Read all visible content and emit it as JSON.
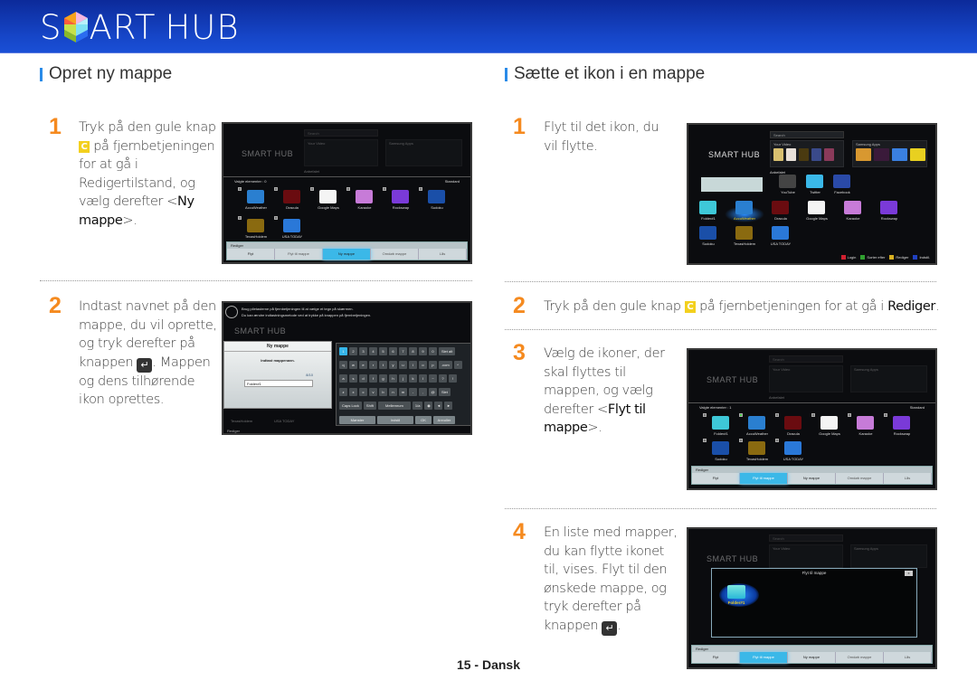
{
  "header": {
    "logo_text": "SMART HUB",
    "logo_s": "S",
    "logo_rest": "ART",
    "logo_hub": "HUB"
  },
  "left": {
    "title": "Opret ny mappe",
    "steps": [
      {
        "number": "1",
        "text_a": "Tryk på den gule knap",
        "key": "C",
        "text_b": "på fjernbetjeningen for at gå i Redigertilstand, og vælg derefter <",
        "bold": "Ny mappe",
        "text_c": ">."
      },
      {
        "number": "2",
        "text_a": "Indtast navnet på den mappe, du vil oprette, og tryk derefter på knappen",
        "key": "↵",
        "text_b": ". Mappen og dens tilhørende ikon oprettes."
      }
    ]
  },
  "right": {
    "title": "Sætte et ikon i en mappe",
    "steps": [
      {
        "number": "1",
        "text": "Flyt til det ikon, du vil flytte."
      },
      {
        "number": "2",
        "text_a": "Tryk på den gule knap",
        "key": "C",
        "text_b": "på fjernbetjeningen for at gå i",
        "bold": "Rediger",
        "text_c": "."
      },
      {
        "number": "3",
        "text_a": "Vælg de ikoner, der skal flyttes til mappen, og vælg derefter <",
        "bold": "Flyt til mappe",
        "text_c": ">."
      },
      {
        "number": "4",
        "text_a": "En liste med mapper, du kan flytte ikonet til, vises. Flyt til den ønskede mappe, og tryk derefter på knappen",
        "key": "↵",
        "text_c": "."
      }
    ]
  },
  "footer": {
    "page": "15 - Dansk"
  },
  "tv_common": {
    "logo": "SMART HUB",
    "search": "Search",
    "your_video": "Your Video",
    "samsung_apps": "Samsung Apps",
    "recommended": "Anbefalet",
    "standard": "Standard",
    "edit_title": "Rediger",
    "close": "x"
  },
  "screens": {
    "edit_new_folder": {
      "selected": "Valgte elementer : 0",
      "apps": [
        {
          "name": "AccuWeather",
          "color": "#2a7fd0"
        },
        {
          "name": "Dracula",
          "color": "#6a0c10"
        },
        {
          "name": "Google Maps",
          "color": "#f4f4f4"
        },
        {
          "name": "Karaoke",
          "color": "#c77bd8"
        },
        {
          "name": "Rockswap",
          "color": "#7a3ad8"
        },
        {
          "name": "Sudoku",
          "color": "#1a4fa8"
        },
        {
          "name": "TexasHoldem",
          "color": "#8a6a10"
        },
        {
          "name": "USA TODAY",
          "color": "#2a78d8"
        }
      ],
      "buttons": [
        "Flyt",
        "Flyt til mappe",
        "Ny mappe",
        "Omdøb mappe",
        "Lås"
      ],
      "active_button": 2
    },
    "keyboard": {
      "hint_1": "Brug piletasterne på fjernbetjeningen til at vælge et tegn på skærmen.",
      "hint_2": "Du kan ændre indtastningsmetode ved at trykke på knappen på fjernbetjeningen.",
      "dialog_title": "Ny mappe",
      "prompt": "Indtast mappenavn.",
      "counter": "8/10",
      "value": "Folder#1",
      "rows": [
        [
          "1",
          "2",
          "3",
          "4",
          "5",
          "6",
          "7",
          "8",
          "9",
          "0",
          "Slet alt"
        ],
        [
          "q",
          "w",
          "e",
          "r",
          "t",
          "y",
          "u",
          "i",
          "o",
          "p",
          ".com",
          "^"
        ],
        [
          "a",
          "s",
          "d",
          "f",
          "g",
          "h",
          "j",
          "k",
          "l",
          "~",
          "?",
          "!"
        ],
        [
          "z",
          "x",
          "c",
          "v",
          "b",
          "n",
          "m",
          "-",
          ",",
          "@",
          "Slet"
        ],
        [
          "Caps Lock",
          "Shift",
          "Mellemrum",
          "1/a",
          "◉",
          "◄",
          "►"
        ]
      ],
      "bottom_buttons": [
        "Mønster",
        "Indstil",
        "OK",
        "Annuller"
      ],
      "behind": [
        "TexasHoldem",
        "USA TODAY"
      ],
      "edit_title": "Rediger"
    },
    "home": {
      "apps_top": [
        "YouTube",
        "Twitter",
        "Facebook"
      ],
      "apps": [
        {
          "name": "Folder#1",
          "color": "#3ec8d8"
        },
        {
          "name": "AccuWeather",
          "color": "#2a7fd0"
        },
        {
          "name": "Dracula",
          "color": "#6a0c10"
        },
        {
          "name": "Google Maps",
          "color": "#f4f4f4"
        },
        {
          "name": "Karaoke",
          "color": "#c77bd8"
        },
        {
          "name": "Rockswap",
          "color": "#7a3ad8"
        },
        {
          "name": "Sudoku",
          "color": "#1a4fa8"
        },
        {
          "name": "TexasHoldem",
          "color": "#8a6a10"
        },
        {
          "name": "USA TODAY",
          "color": "#2a78d8"
        }
      ],
      "focused": "AccuWeather",
      "footer": [
        {
          "key": "A",
          "label": "Login",
          "color": "#d02030"
        },
        {
          "key": "B",
          "label": "Sorter efter",
          "color": "#30a030"
        },
        {
          "key": "C",
          "label": "Rediger",
          "color": "#d8b020"
        },
        {
          "key": "D",
          "label": "Indstil.",
          "color": "#2040c0"
        }
      ]
    },
    "edit_move": {
      "selected": "Valgte elementer : 1",
      "apps": [
        {
          "name": "Folder#1",
          "color": "#3ec8d8"
        },
        {
          "name": "AccuWeather",
          "color": "#2a7fd0"
        },
        {
          "name": "Dracula",
          "color": "#6a0c10"
        },
        {
          "name": "Google Maps",
          "color": "#f4f4f4"
        },
        {
          "name": "Karaoke",
          "color": "#c77bd8"
        },
        {
          "name": "Rockswap",
          "color": "#7a3ad8"
        },
        {
          "name": "Sudoku",
          "color": "#1a4fa8"
        },
        {
          "name": "TexasHoldem",
          "color": "#8a6a10"
        },
        {
          "name": "USA TODAY",
          "color": "#2a78d8"
        }
      ],
      "checked": 1,
      "buttons": [
        "Flyt",
        "Flyt til mappe",
        "Ny mappe",
        "Omdøb mappe",
        "Lås"
      ],
      "active_button": 1
    },
    "move_dialog": {
      "title": "Flyt til mappe",
      "folder": "Folder#1",
      "buttons": [
        "Flyt",
        "Flyt til mappe",
        "Ny mappe",
        "Omdøb mappe",
        "Lås"
      ],
      "active_button": 1
    }
  },
  "colors": {
    "header_blue": "#1646c8",
    "accent_bar": "#2a8be8",
    "step_number": "#f58a1f",
    "yellow_key": "#f3d01e",
    "highlight": "#3bb8e8"
  }
}
